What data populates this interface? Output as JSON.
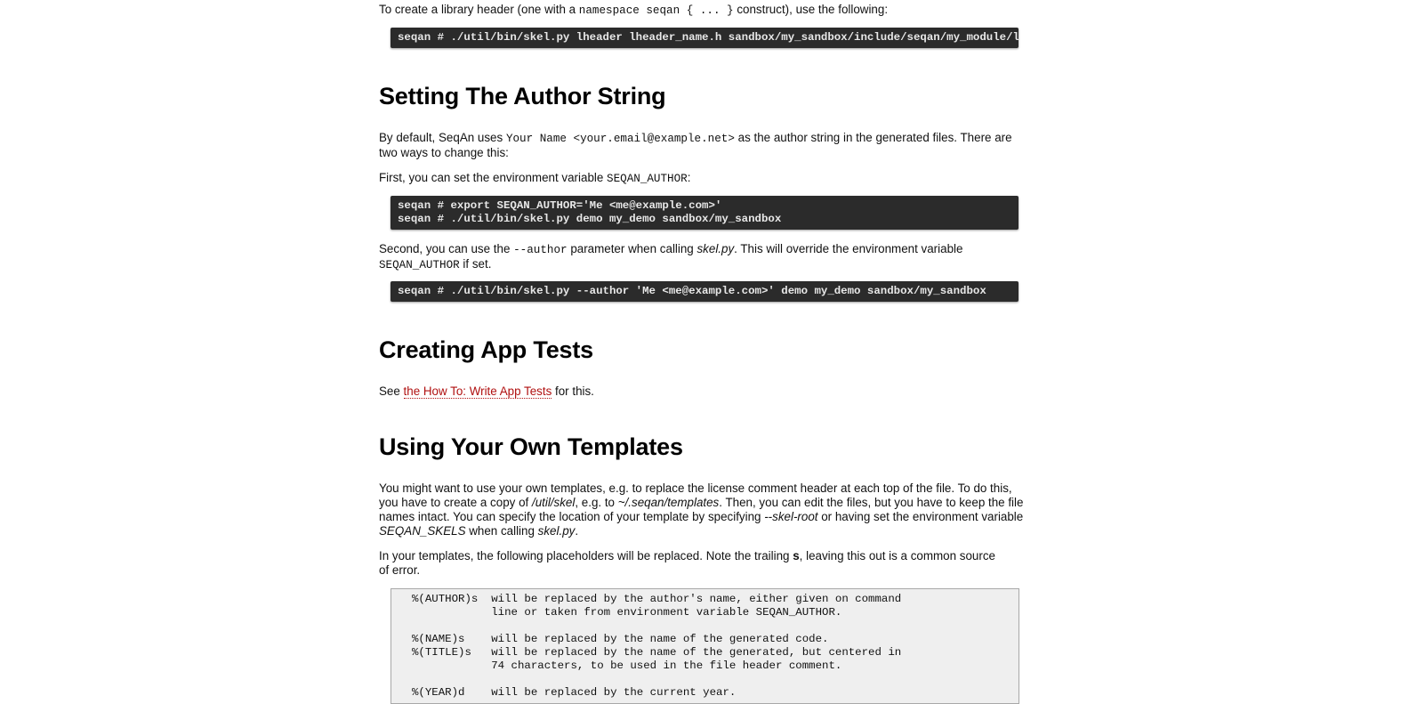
{
  "intro": {
    "pre": "To create a library header (one with a ",
    "code": "namespace seqan { ... }",
    "post": " construct), use the following:"
  },
  "code1": "seqan # ./util/bin/skel.py lheader lheader_name.h sandbox/my_sandbox/include/seqan/my_module/lheader_name.h",
  "section_author": {
    "heading": "Setting The Author String",
    "p1": {
      "pre": "By default, SeqAn uses ",
      "code": "Your Name <your.email@example.net>",
      "post": " as the author string in the generated files. There are two ways to change this:"
    },
    "p2": {
      "pre": "First, you can set the environment variable ",
      "code": "SEQAN_AUTHOR",
      "post": ":"
    },
    "code2": "seqan # export SEQAN_AUTHOR='Me <me@example.com>'\nseqan # ./util/bin/skel.py demo my_demo sandbox/my_sandbox",
    "p3": {
      "pre": "Second, you can use the ",
      "code": "--author",
      "mid": " parameter when calling ",
      "em": "skel.py",
      "mid2": ". This will override the environment variable ",
      "code2": "SEQAN_AUTHOR",
      "post": " if set."
    },
    "code3": "seqan # ./util/bin/skel.py --author 'Me <me@example.com>' demo my_demo sandbox/my_sandbox"
  },
  "section_tests": {
    "heading": "Creating App Tests",
    "pre": "See ",
    "link": "the How To: Write App Tests",
    "post": " for this."
  },
  "section_templates": {
    "heading": "Using Your Own Templates",
    "p1": {
      "a": "You might want to use your own templates, e.g. to replace the license comment header at each top of the file. To do this, you have to create a copy of ",
      "em1": "/util/skel",
      "b": ", e.g. to ",
      "em2": "~/.seqan/templates",
      "c": ". Then, you can edit the files, but you have to keep the file names intact. You can specify the location of your template by specifying ",
      "em3": "--skel-root",
      "d": " or having set the environment variable ",
      "em4": "SEQAN_SKELS",
      "e": " when calling ",
      "em5": "skel.py",
      "f": "."
    },
    "p2": {
      "pre": "In your templates, the following placeholders will be replaced. Note the trailing ",
      "strong": "s",
      "post": ", leaving this out is a common source of error."
    },
    "code4": "%(AUTHOR)s  will be replaced by the author's name, either given on command\n            line or taken from environment variable SEQAN_AUTHOR.\n\n%(NAME)s    will be replaced by the name of the generated code.\n%(TITLE)s   will be replaced by the name of the generated, but centered in\n            74 characters, to be used in the file header comment.\n\n%(YEAR)d    will be replaced by the current year."
  }
}
